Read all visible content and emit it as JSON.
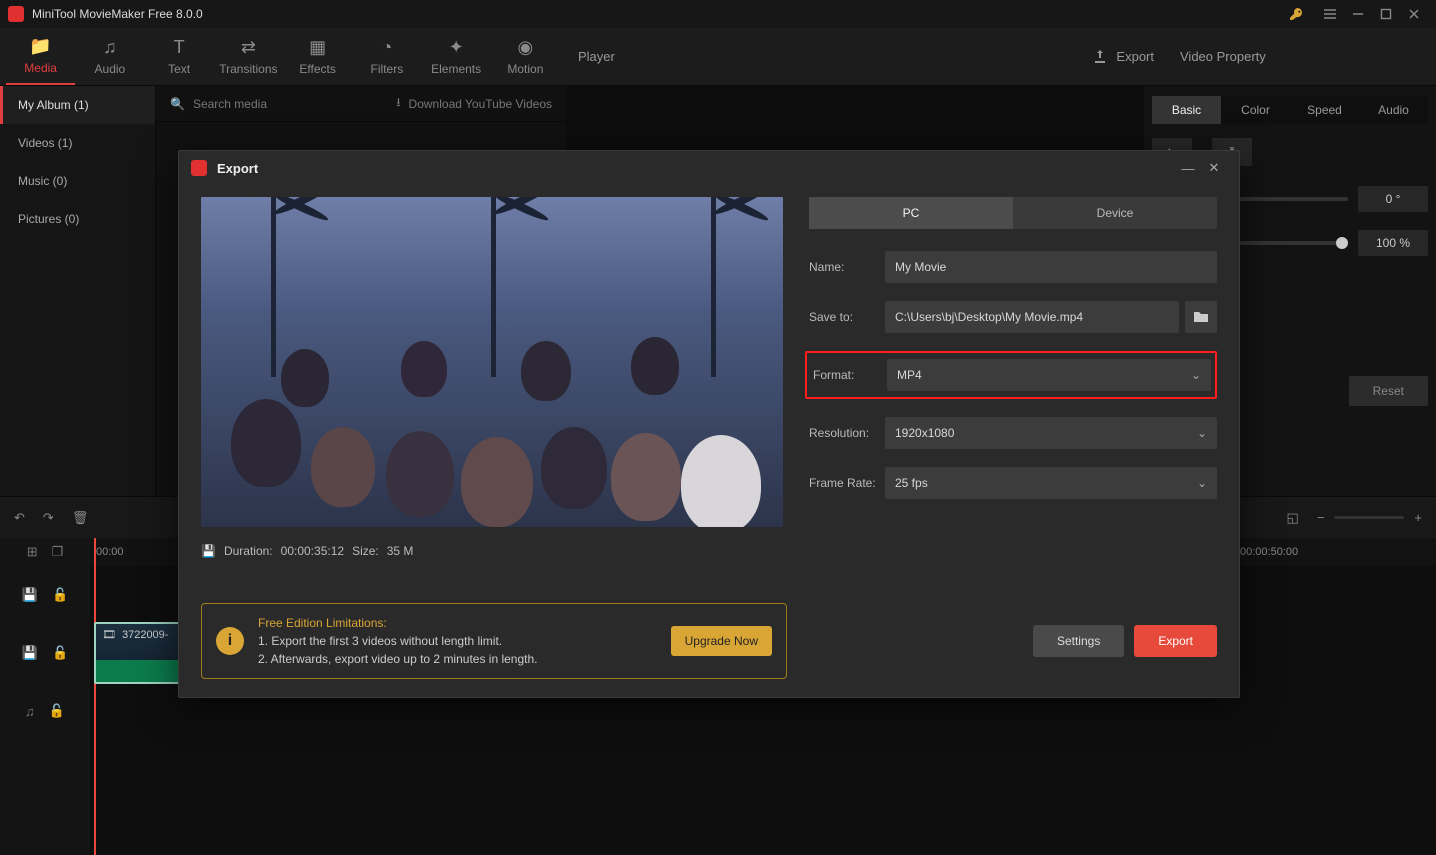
{
  "app": {
    "title": "MiniTool MovieMaker Free 8.0.0"
  },
  "toolbar": {
    "items": [
      {
        "label": "Media"
      },
      {
        "label": "Audio"
      },
      {
        "label": "Text"
      },
      {
        "label": "Transitions"
      },
      {
        "label": "Effects"
      },
      {
        "label": "Filters"
      },
      {
        "label": "Elements"
      },
      {
        "label": "Motion"
      }
    ]
  },
  "sidebar": {
    "items": [
      {
        "label": "My Album (1)"
      },
      {
        "label": "Videos (1)"
      },
      {
        "label": "Music (0)"
      },
      {
        "label": "Pictures (0)"
      }
    ]
  },
  "media_search": {
    "placeholder": "Search media",
    "download_label": "Download YouTube Videos"
  },
  "player": {
    "title": "Player",
    "export_label": "Export"
  },
  "video_property": {
    "title": "Video Property",
    "tabs": [
      "Basic",
      "Color",
      "Speed",
      "Audio"
    ],
    "rotate_value": "0 °",
    "opacity_value": "100 %",
    "reset_label": "Reset"
  },
  "timeline": {
    "ticks": [
      "00:00",
      "00:00:50:00"
    ],
    "clip_label": "3722009-"
  },
  "export_dialog": {
    "title": "Export",
    "tabs": {
      "pc": "PC",
      "device": "Device"
    },
    "fields": {
      "name_label": "Name:",
      "name_value": "My Movie",
      "save_label": "Save to:",
      "save_value": "C:\\Users\\bj\\Desktop\\My Movie.mp4",
      "format_label": "Format:",
      "format_value": "MP4",
      "res_label": "Resolution:",
      "res_value": "1920x1080",
      "fps_label": "Frame Rate:",
      "fps_value": "25 fps"
    },
    "info": {
      "duration_label": "Duration:",
      "duration_value": "00:00:35:12",
      "size_label": "Size:",
      "size_value": "35 M"
    },
    "limitations": {
      "header": "Free Edition Limitations:",
      "line1": "1. Export the first 3 videos without length limit.",
      "line2": "2. Afterwards, export video up to 2 minutes in length.",
      "upgrade_label": "Upgrade Now"
    },
    "buttons": {
      "settings": "Settings",
      "export": "Export"
    }
  }
}
